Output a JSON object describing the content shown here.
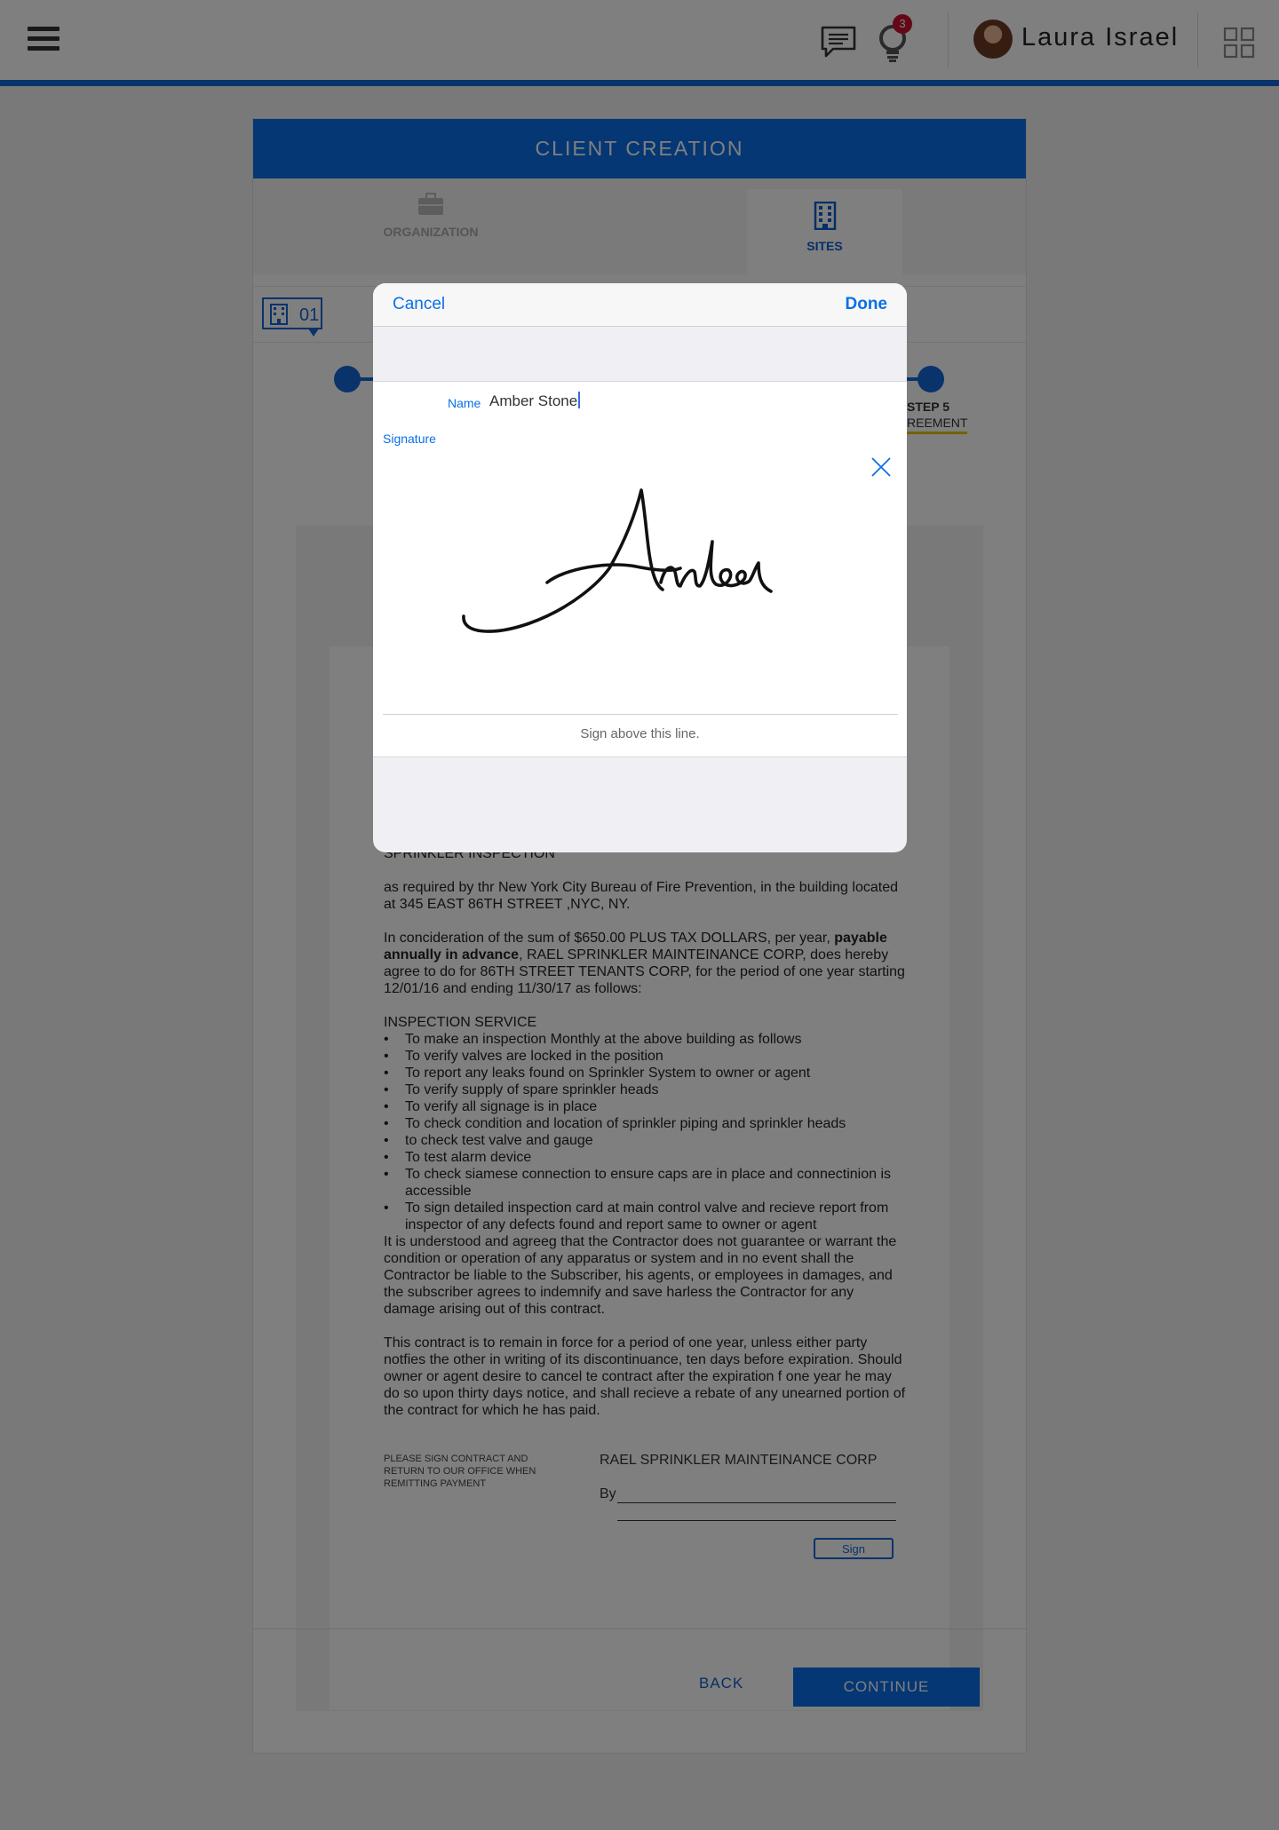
{
  "topbar": {
    "notification_count": "3",
    "user_name": "Laura Israel",
    "icons": [
      "menu-icon",
      "chat-icon",
      "lightbulb-icon",
      "apps-grid-icon"
    ]
  },
  "card": {
    "title": "CLIENT CREATION",
    "tabs": [
      {
        "label": "ORGANIZATION",
        "icon": "briefcase-icon",
        "active": false
      },
      {
        "label": "SITES",
        "icon": "building-icon",
        "active": true
      }
    ],
    "site_tag": "01",
    "step5": {
      "label": "STEP 5",
      "sublabel": "REEMENT"
    },
    "accent_color": "#0a6fe8"
  },
  "document": {
    "heading": "SPRINKLER INSPECTION",
    "para1": "as required by thr New York City Bureau of  Fire Prevention, in the building located at 345 EAST 86TH STREET ,NYC, NY.",
    "para2_pre": "In concideration of the sum of $650.00 PLUS TAX DOLLARS, per year, ",
    "para2_bold": "payable annually in advance",
    "para2_post": ", RAEL SPRINKLER MAINTEINANCE CORP, does hereby agree to do for 86TH STREET TENANTS CORP,  for the period of one year starting 12/01/16 and ending 11/30/17 as follows:",
    "service_heading": "INSPECTION SERVICE",
    "service_items": [
      "To make an inspection Monthly at the above building as follows",
      "To verify valves are locked in the position",
      "To report any leaks found on Sprinkler System to owner or agent",
      "To verify supply of spare sprinkler heads",
      "To verify all signage is in place",
      "To check condition and location of sprinkler piping and sprinkler heads",
      "to check test valve and gauge",
      "To test alarm device",
      "To check siamese connection to ensure caps are in place and connectinion is accessible",
      "To sign detailed inspection card at main control valve and recieve report from inspector of any defects found and report same to owner or agent"
    ],
    "para3": "It is understood and agreeg that the Contractor does not guarantee or warrant the condition or operation of any apparatus or system and in no event shall the Contractor be liable to the Subscriber, his agents, or employees in damages, and the subscriber agrees to indemnify and save harless the Contractor for any damage arising out of this contract.",
    "para4": "This contract is to remain in force for a period of one year, unless either party notfies the other in writing of its discontinuance, ten days before expiration. Should owner or agent desire to cancel te contract after the expiration f one year he may do so upon thirty days notice, and shall recieve a rebate of any unearned portion of the contract for which he has paid.",
    "sign_note": "PLEASE SIGN CONTRACT AND RETURN TO OUR OFFICE WHEN REMITTING PAYMENT",
    "corp_name": "RAEL SPRINKLER MAINTEINANCE CORP",
    "by_label": "By",
    "sign_button": "Sign"
  },
  "footer": {
    "back_label": "BACK",
    "continue_label": "CONTINUE"
  },
  "modal": {
    "cancel_label": "Cancel",
    "done_label": "Done",
    "name_label": "Name",
    "name_value": "Amber Stone",
    "signature_label": "Signature",
    "sign_hint": "Sign above this line.",
    "signature_text": "Amber"
  }
}
